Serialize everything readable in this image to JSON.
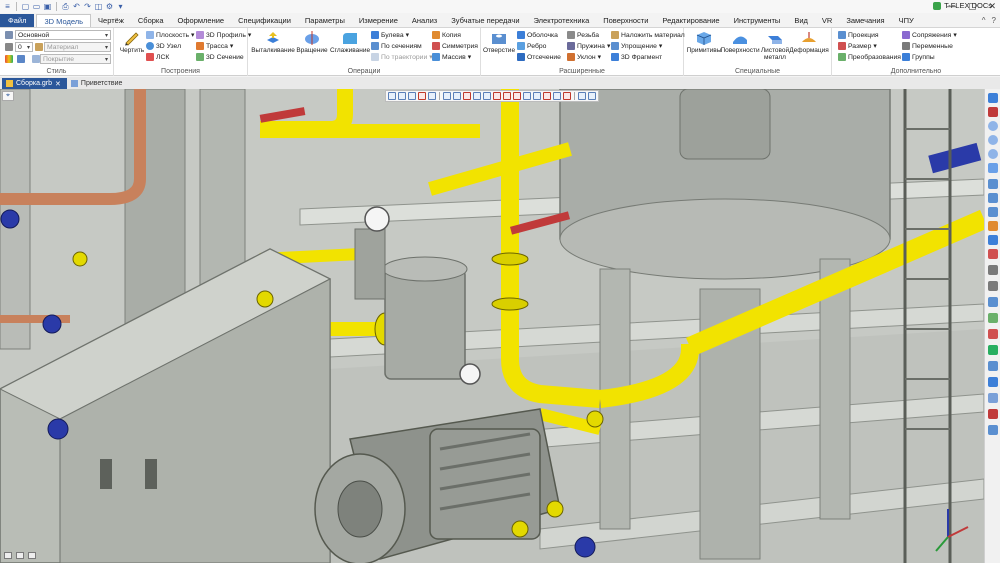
{
  "titlebar": {
    "app_name": "T-FLEX DOCs"
  },
  "menu": {
    "tabs": [
      "Файл",
      "3D Модель",
      "Чертёж",
      "Сборка",
      "Оформление",
      "Спецификации",
      "Параметры",
      "Измерение",
      "Анализ",
      "Зубчатые передачи",
      "Электротехника",
      "Поверхности",
      "Редактирование",
      "Инструменты",
      "Вид",
      "VR",
      "Замечания",
      "ЧПУ"
    ],
    "active": "3D Модель"
  },
  "ribbon": {
    "style": {
      "label": "Стиль",
      "layer_value": "Основной",
      "material_value": "0",
      "material_placeholder": "Материал",
      "coating_placeholder": "Покрытие"
    },
    "construction": {
      "label": "Построения",
      "draw": "Чертить",
      "plane": "Плоскость",
      "node3d": "3D Узел",
      "lsk": "ЛСК",
      "profile3d": "3D Профиль",
      "route": "Трасса",
      "section3d": "3D Сечение"
    },
    "operations": {
      "label": "Операции",
      "extrude": "Выталкивание",
      "revolve": "Вращение",
      "smooth": "Сглаживание",
      "boolean": "Булева",
      "by_sections": "По сечениям",
      "by_path": "По траектории",
      "copy": "Копия",
      "symmetry": "Симметрия",
      "array": "Массив"
    },
    "extended": {
      "label": "Расширенные",
      "hole": "Отверстие",
      "shell": "Оболочка",
      "rib": "Ребро",
      "cut": "Отсечение",
      "thread": "Резьба",
      "spring": "Пружина",
      "slope": "Уклон",
      "apply_material": "Наложить материал",
      "simplify": "Упрощение",
      "fragment3d": "3D Фрагмент"
    },
    "special": {
      "label": "Специальные",
      "primitives": "Примитивы",
      "surfaces": "Поверхности",
      "sheet_metal": "Листовой металл",
      "deformation": "Деформация"
    },
    "additional": {
      "label": "Дополнительно",
      "projection": "Проекция",
      "size": "Размер",
      "transforms": "Преобразования",
      "mates": "Сопряжения",
      "variables": "Переменные",
      "groups": "Группы"
    }
  },
  "documents": {
    "tabs": [
      "Сборка.grb",
      "Приветствие"
    ],
    "active": "Сборка.grb"
  },
  "colors": {
    "accent": "#2b579a",
    "pipe_yellow": "#f2e300",
    "pipe_copper": "#c8815c",
    "steel_gray": "#a8aca6",
    "flange_blue": "#2a3aa8",
    "frame_light": "#d7dad5"
  }
}
